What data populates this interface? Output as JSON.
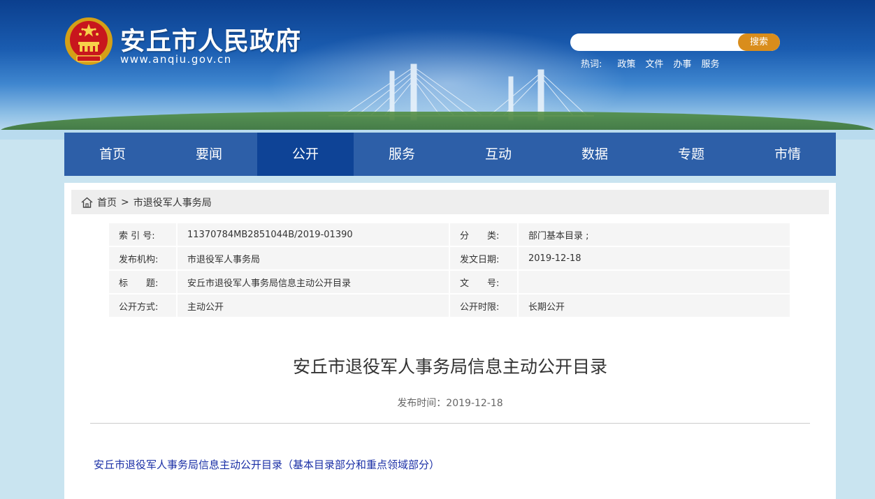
{
  "header": {
    "site_title": "安丘市人民政府",
    "site_url": "www.anqiu.gov.cn",
    "search": {
      "placeholder": "",
      "button_label": "搜索"
    },
    "hotwords": {
      "label": "热词:",
      "items": [
        "政策",
        "文件",
        "办事",
        "服务"
      ]
    }
  },
  "nav": {
    "items": [
      "首页",
      "要闻",
      "公开",
      "服务",
      "互动",
      "数据",
      "专题",
      "市情"
    ],
    "active_index": 2
  },
  "breadcrumb": {
    "home": "首页",
    "separator": ">",
    "current": "市退役军人事务局"
  },
  "meta": {
    "rows": [
      {
        "label1": "索 引 号:",
        "value1": "11370784MB2851044B/2019-01390",
        "label2": "分　　类:",
        "value2": "部门基本目录 ;"
      },
      {
        "label1": "发布机构:",
        "value1": "市退役军人事务局",
        "label2": "发文日期:",
        "value2": "2019-12-18"
      },
      {
        "label1": "标　　题:",
        "value1": "安丘市退役军人事务局信息主动公开目录",
        "label2": "文　　号:",
        "value2": ""
      },
      {
        "label1": "公开方式:",
        "value1": "主动公开",
        "label2": "公开时限:",
        "value2": "长期公开"
      }
    ]
  },
  "article": {
    "title": "安丘市退役军人事务局信息主动公开目录",
    "publish_time": "发布时间：2019-12-18",
    "attachment_link": "安丘市退役军人事务局信息主动公开目录（基本目录部分和重点领域部分）"
  },
  "colors": {
    "nav_bg": "#2d5fa8",
    "nav_active": "#0e4396",
    "search_button": "#d98d1c",
    "link": "#1a2fa6"
  },
  "icons": {
    "emblem": "national-emblem",
    "home": "home-icon"
  }
}
